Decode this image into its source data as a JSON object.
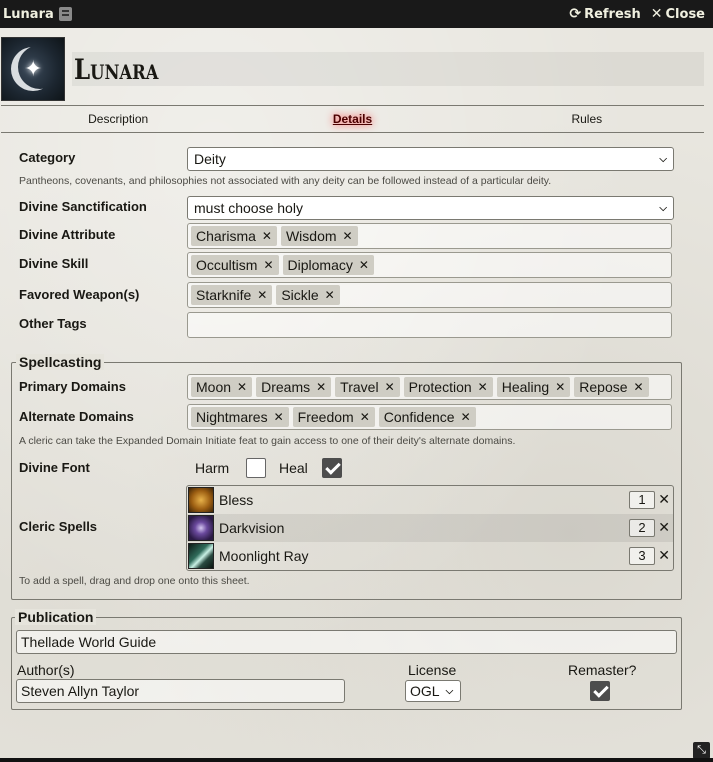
{
  "window": {
    "title": "Lunara",
    "refresh_label": "Refresh",
    "close_label": "Close"
  },
  "header": {
    "name": "Lunara"
  },
  "tabs": [
    {
      "label": "Description"
    },
    {
      "label": "Details",
      "active": true
    },
    {
      "label": "Rules"
    }
  ],
  "details": {
    "category": {
      "label": "Category",
      "value": "Deity"
    },
    "category_hint": "Pantheons, covenants, and philosophies not associated with any deity can be followed instead of a particular deity.",
    "sanctification": {
      "label": "Divine Sanctification",
      "value": "must choose holy"
    },
    "attribute": {
      "label": "Divine Attribute",
      "tags": [
        "Charisma",
        "Wisdom"
      ]
    },
    "skill": {
      "label": "Divine Skill",
      "tags": [
        "Occultism",
        "Diplomacy"
      ]
    },
    "weapons": {
      "label": "Favored Weapon(s)",
      "tags": [
        "Starknife",
        "Sickle"
      ]
    },
    "other_tags": {
      "label": "Other Tags",
      "tags": []
    }
  },
  "spellcasting": {
    "legend": "Spellcasting",
    "primary": {
      "label": "Primary Domains",
      "tags": [
        "Moon",
        "Dreams",
        "Travel",
        "Protection",
        "Healing",
        "Repose"
      ]
    },
    "alternate": {
      "label": "Alternate Domains",
      "tags": [
        "Nightmares",
        "Freedom",
        "Confidence"
      ]
    },
    "alternate_hint": "A cleric can take the Expanded Domain Initiate feat to gain access to one of their deity's alternate domains.",
    "font": {
      "label": "Divine Font",
      "harm_label": "Harm",
      "harm_checked": false,
      "heal_label": "Heal",
      "heal_checked": true
    },
    "spells_label": "Cleric Spells",
    "spells": [
      {
        "name": "Bless",
        "level": "1"
      },
      {
        "name": "Darkvision",
        "level": "2"
      },
      {
        "name": "Moonlight Ray",
        "level": "3"
      }
    ],
    "spells_hint": "To add a spell, drag and drop one onto this sheet."
  },
  "publication": {
    "legend": "Publication",
    "title_value": "Thellade World Guide",
    "authors_label": "Author(s)",
    "authors_value": "Steven Allyn Taylor",
    "license_label": "License",
    "license_value": "OGL",
    "remaster_label": "Remaster?",
    "remaster_checked": true
  }
}
